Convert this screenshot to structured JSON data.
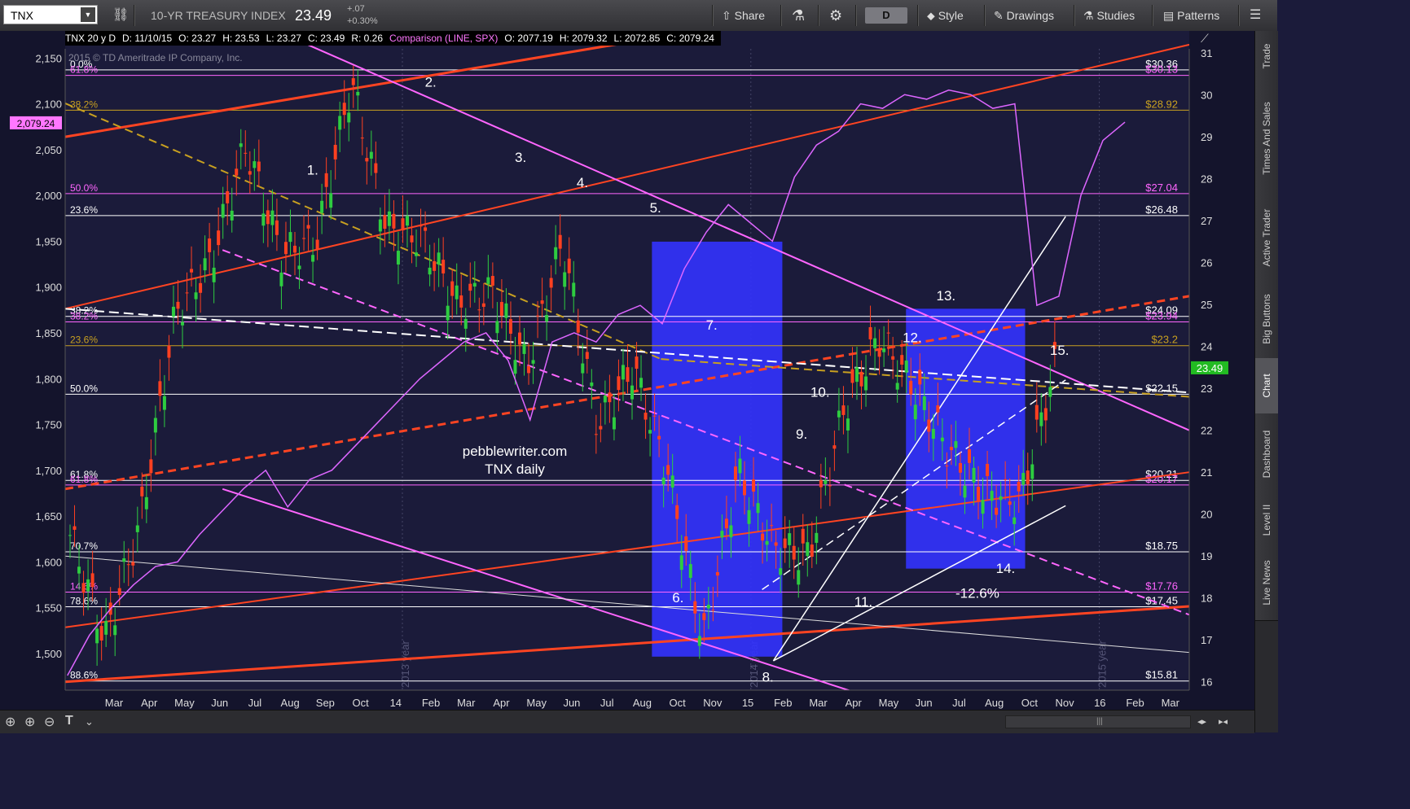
{
  "toolbar": {
    "symbol": "TNX",
    "description": "10-YR TREASURY INDEX",
    "last": "23.49",
    "change": "+.07",
    "change_pct": "+0.30%",
    "share_label": "Share",
    "aggregation": "D",
    "style_label": "Style",
    "drawings_label": "Drawings",
    "studies_label": "Studies",
    "patterns_label": "Patterns"
  },
  "infobar": {
    "symbol_period": "TNX 20 y D",
    "date": "D: 11/10/15",
    "open": "O: 23.27",
    "high": "H: 23.53",
    "low": "L: 23.27",
    "close": "C: 23.49",
    "range": "R: 0.26",
    "comparison": "Comparison (LINE, SPX)",
    "cmp_open": "O: 2077.19",
    "cmp_high": "H: 2079.32",
    "cmp_low": "L: 2072.85",
    "cmp_close": "C: 2079.24"
  },
  "copyright": "2015 © TD Ameritrade IP Company, Inc.",
  "right_tabs": [
    "Trade",
    "Times And Sales",
    "Active Trader",
    "Big Buttons",
    "Chart",
    "Dashboard",
    "Level II",
    "Live News"
  ],
  "colors": {
    "background": "#1b1b3a",
    "price_up": "#2ecc40",
    "price_down": "#ff4020",
    "spx_line": "#dd66ff",
    "fib_pink": "#ff66ff",
    "fib_gold": "#c8a020",
    "trend_orange": "#ff4422",
    "highlight_blue": "#3333ff"
  },
  "chart_data": {
    "type": "line",
    "title": "",
    "watermark": [
      "pebblewriter.com",
      "TNX daily"
    ],
    "x_tick_labels": [
      "Mar",
      "Apr",
      "May",
      "Jun",
      "Jul",
      "Aug",
      "Sep",
      "Oct",
      "14",
      "Feb",
      "Mar",
      "Apr",
      "May",
      "Jun",
      "Jul",
      "Aug",
      "Oct",
      "Nov",
      "15",
      "Feb",
      "Mar",
      "Apr",
      "May",
      "Jun",
      "Jul",
      "Aug",
      "Oct",
      "Nov",
      "16",
      "Feb",
      "Mar"
    ],
    "year_marks": [
      "2013 year",
      "2014 year",
      "2015 year"
    ],
    "left_axis": {
      "label": "SPX",
      "ticks": [
        2150,
        2100,
        2050,
        2000,
        1950,
        1900,
        1850,
        1800,
        1750,
        1700,
        1650,
        1600,
        1550,
        1500
      ],
      "range": [
        1460,
        2160
      ]
    },
    "right_axis": {
      "label": "TNX",
      "ticks": [
        31,
        30,
        29,
        28,
        27,
        26,
        25,
        24,
        23,
        22,
        21,
        20,
        19,
        18,
        17,
        16
      ],
      "range": [
        15.8,
        31.1
      ]
    },
    "spx_last_label": "2,079.24",
    "tnx_last_label": "23.49",
    "fib_levels_left": [
      {
        "label": "0.0%",
        "value": 2137,
        "color": "#ffffff"
      },
      {
        "label": "61.8%",
        "value": 2131,
        "color": "#ff66ff"
      },
      {
        "label": "38.2%",
        "value": 2093,
        "color": "#c8a020"
      },
      {
        "label": "50.0%",
        "value": 2002,
        "color": "#ff66ff"
      },
      {
        "label": "23.6%",
        "value": 1978,
        "color": "#ffffff"
      },
      {
        "label": "38.2%",
        "value": 1868,
        "color": "#ffffff"
      },
      {
        "label": "38.2%",
        "value": 1862,
        "color": "#ff66ff"
      },
      {
        "label": "23.6%",
        "value": 1836,
        "color": "#c8a020"
      },
      {
        "label": "50.0%",
        "value": 1783,
        "color": "#ffffff"
      },
      {
        "label": "61.8%",
        "value": 1689,
        "color": "#ffffff"
      },
      {
        "label": "61.8%",
        "value": 1684,
        "color": "#ff66ff"
      },
      {
        "label": "70.7%",
        "value": 1611,
        "color": "#ffffff"
      },
      {
        "label": "14.6%",
        "value": 1567,
        "color": "#ff66ff"
      },
      {
        "label": "78.6%",
        "value": 1551,
        "color": "#ffffff"
      },
      {
        "label": "88.6%",
        "value": 1470,
        "color": "#ffffff"
      }
    ],
    "fib_values_right": [
      {
        "label": "$30.36",
        "color": "#ffffff"
      },
      {
        "label": "$30.13",
        "color": "#ff66ff"
      },
      {
        "label": "$28.92",
        "color": "#c8a020"
      },
      {
        "label": "$27.04",
        "color": "#ff66ff"
      },
      {
        "label": "$26.48",
        "color": "#ffffff"
      },
      {
        "label": "$24.09",
        "color": "#ffffff"
      },
      {
        "label": "$23.94",
        "color": "#ff66ff"
      },
      {
        "label": "$23.2",
        "color": "#c8a020"
      },
      {
        "label": "$22.15",
        "color": "#ffffff"
      },
      {
        "label": "$20.21",
        "color": "#ffffff"
      },
      {
        "label": "$20.17",
        "color": "#ff66ff"
      },
      {
        "label": "$18.75",
        "color": "#ffffff"
      },
      {
        "label": "$17.76",
        "color": "#ff66ff"
      },
      {
        "label": "$17.45",
        "color": "#ffffff"
      },
      {
        "label": "$15.81",
        "color": "#ffffff"
      }
    ],
    "annotations": [
      "1.",
      "2.",
      "3.",
      "4.",
      "5.",
      "6.",
      "7.",
      "8.",
      "9.",
      "10.",
      "11.",
      "12.",
      "13.",
      "14.",
      "15.",
      "-12.6%"
    ],
    "highlight_periods": [
      {
        "from": "2014-08",
        "to": "2015-01",
        "tnx_range": [
          16.6,
          26.5
        ]
      },
      {
        "from": "2015-05",
        "to": "2015-09",
        "tnx_range": [
          18.7,
          24.9
        ]
      }
    ],
    "spx_series": {
      "name": "SPX",
      "x": [
        0,
        0.02,
        0.04,
        0.06,
        0.08,
        0.1,
        0.12,
        0.14,
        0.16,
        0.18,
        0.2,
        0.22,
        0.24,
        0.26,
        0.28,
        0.3,
        0.32,
        0.34,
        0.36,
        0.38,
        0.4,
        0.42,
        0.44,
        0.46,
        0.48,
        0.5,
        0.52,
        0.54,
        0.56,
        0.58,
        0.6,
        0.62,
        0.64,
        0.66,
        0.68,
        0.7,
        0.72,
        0.74,
        0.76,
        0.78,
        0.8,
        0.82,
        0.84,
        0.86,
        0.88,
        0.9,
        0.92,
        0.94,
        0.96
      ],
      "values": [
        1476,
        1520,
        1550,
        1575,
        1595,
        1600,
        1630,
        1655,
        1680,
        1700,
        1660,
        1690,
        1700,
        1725,
        1750,
        1775,
        1800,
        1820,
        1840,
        1850,
        1820,
        1755,
        1840,
        1850,
        1840,
        1870,
        1880,
        1860,
        1920,
        1960,
        1990,
        1970,
        1950,
        2020,
        2055,
        2070,
        2100,
        2095,
        2110,
        2105,
        2115,
        2110,
        2095,
        2100,
        1880,
        1890,
        2000,
        2060,
        2080
      ]
    },
    "tnx_ohlc_summary": [
      {
        "period": "Mar 13",
        "close": 19.5
      },
      {
        "period": "Apr 13",
        "close": 17.0
      },
      {
        "period": "May 13",
        "close": 19.8
      },
      {
        "period": "Jun 13",
        "close": 24.8
      },
      {
        "period": "Jul 13",
        "close": 26.0
      },
      {
        "period": "Aug 13",
        "close": 28.8
      },
      {
        "period": "Sep 13",
        "close": 26.2
      },
      {
        "period": "Oct 13",
        "close": 26.5
      },
      {
        "period": "Dec 13",
        "close": 30.3
      },
      {
        "period": "Feb 14",
        "close": 26.8
      },
      {
        "period": "Apr 14",
        "close": 26.6
      },
      {
        "period": "May 14",
        "close": 25.0
      },
      {
        "period": "Jul 14",
        "close": 25.3
      },
      {
        "period": "Aug 14",
        "close": 23.5
      },
      {
        "period": "Sep 14",
        "close": 26.5
      },
      {
        "period": "Oct 14",
        "close": 22.1
      },
      {
        "period": "Nov 14",
        "close": 23.5
      },
      {
        "period": "Dec 14",
        "close": 21.0
      },
      {
        "period": "Jan 15",
        "close": 17.0
      },
      {
        "period": "Feb 15",
        "close": 21.0
      },
      {
        "period": "Mar 15",
        "close": 19.2
      },
      {
        "period": "Apr 15",
        "close": 19.0
      },
      {
        "period": "May 15",
        "close": 22.5
      },
      {
        "period": "Jun 15",
        "close": 24.2
      },
      {
        "period": "Jul 15",
        "close": 23.0
      },
      {
        "period": "Aug 15",
        "close": 21.5
      },
      {
        "period": "Sep 15",
        "close": 20.5
      },
      {
        "period": "Oct 15",
        "close": 20.3
      },
      {
        "period": "Nov 15",
        "close": 23.49
      }
    ]
  }
}
